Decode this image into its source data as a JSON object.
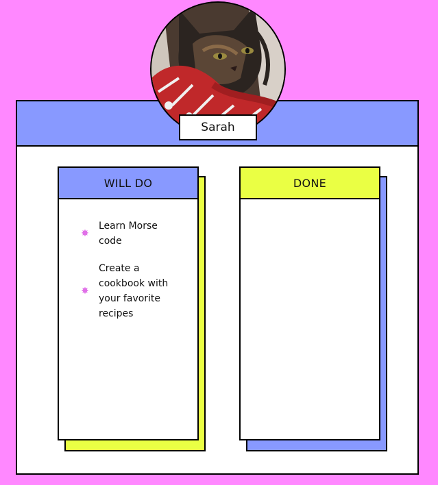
{
  "profile": {
    "name": "Sarah",
    "avatar_icon": "cat-photo"
  },
  "colors": {
    "background": "#ff88ff",
    "header": "#8899ff",
    "will_do_header": "#8899ff",
    "will_do_shadow": "#eaff44",
    "done_header": "#eaff44",
    "done_shadow": "#8899ff",
    "bullet": "#e070e8"
  },
  "columns": {
    "will_do": {
      "title": "WILL DO",
      "tasks": [
        {
          "text": "Learn Morse code",
          "icon": "starburst-bullet-icon"
        },
        {
          "text": "Create a cookbook with your favorite recipes",
          "icon": "starburst-bullet-icon"
        }
      ]
    },
    "done": {
      "title": "DONE",
      "tasks": []
    }
  }
}
